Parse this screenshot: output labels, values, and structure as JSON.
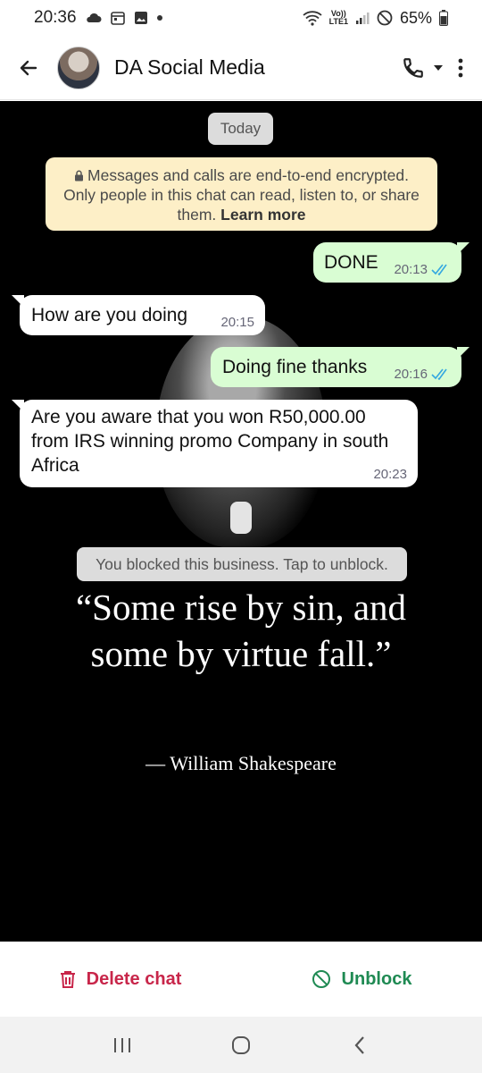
{
  "status_bar": {
    "time": "20:36",
    "battery": "65%",
    "volte_label": "Vo))\nLTE1"
  },
  "header": {
    "contact_name": "DA Social Media"
  },
  "chat": {
    "date_chip": "Today",
    "encryption_notice": "Messages and calls are end-to-end encrypted. Only people in this chat can read, listen to, or share them.",
    "encryption_link": "Learn more",
    "messages": [
      {
        "direction": "out",
        "text": "DONE",
        "time": "20:13",
        "read": true
      },
      {
        "direction": "in",
        "text": "How are you doing",
        "time": "20:15"
      },
      {
        "direction": "out",
        "text": "Doing fine thanks",
        "time": "20:16",
        "read": true
      },
      {
        "direction": "in",
        "text": "Are you aware that you won R50,000.00 from IRS  winning promo Company in south Africa",
        "time": "20:23"
      }
    ],
    "blocked_notice": "You blocked this business. Tap to unblock.",
    "wallpaper_quote": "“Some rise by sin, and some by virtue fall.”",
    "wallpaper_author": "— William Shakespeare"
  },
  "actions": {
    "delete_label": "Delete chat",
    "unblock_label": "Unblock"
  },
  "colors": {
    "outgoing_bubble": "#d9fdd3",
    "incoming_bubble": "#ffffff",
    "read_ticks": "#34a8e0",
    "delete": "#c8264a",
    "unblock": "#1f8a53",
    "encryption_banner": "#fdefc7"
  }
}
